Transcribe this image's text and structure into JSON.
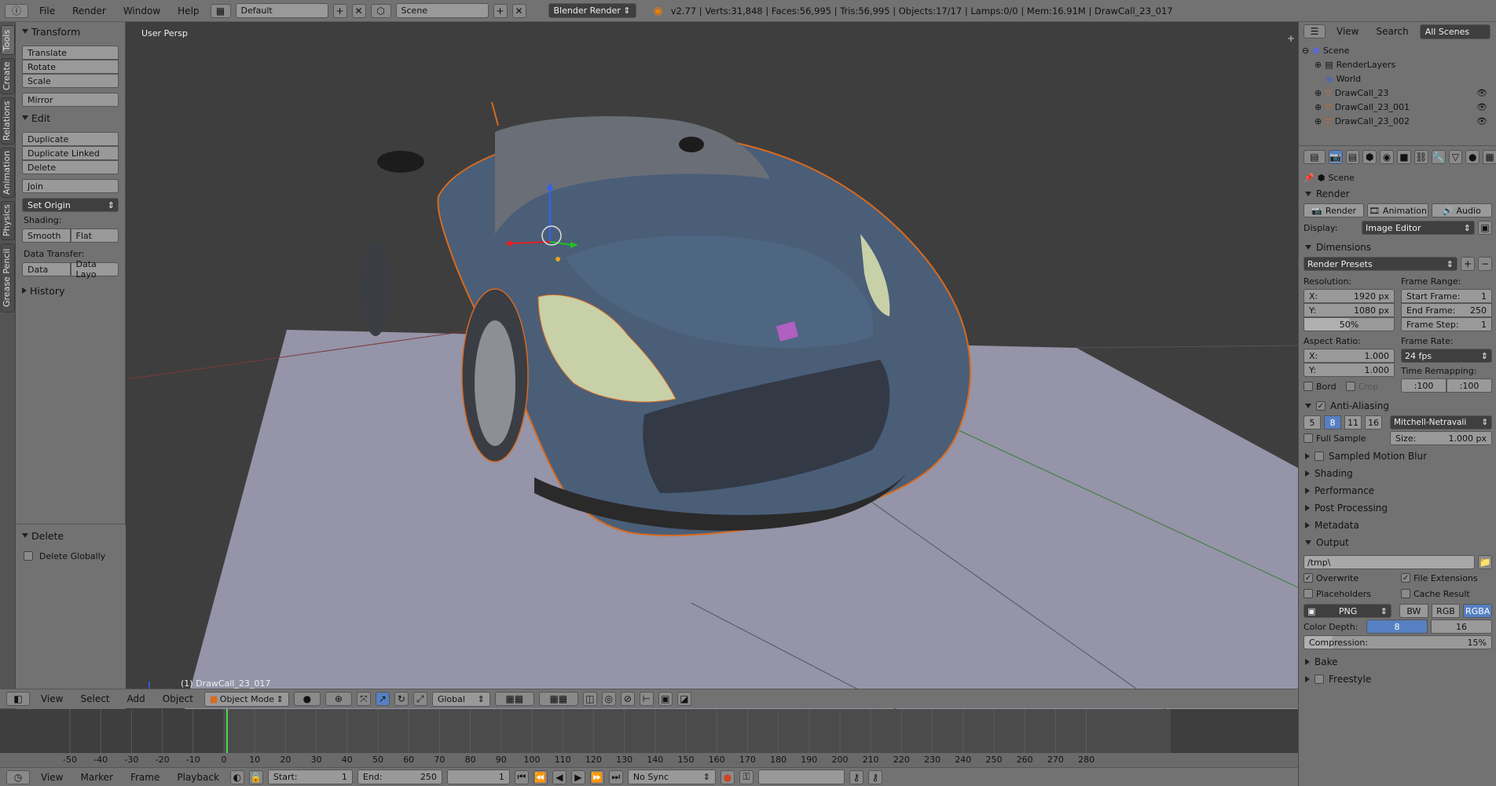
{
  "topbar": {
    "menus": [
      "File",
      "Render",
      "Window",
      "Help"
    ],
    "layout": "Default",
    "scene": "Scene",
    "engine": "Blender Render",
    "stats": "v2.77 | Verts:31,848 | Faces:56,995 | Tris:56,995 | Objects:17/17 | Lamps:0/0 | Mem:16.91M | DrawCall_23_017"
  },
  "lefttabs": [
    "Tools",
    "Create",
    "Relations",
    "Animation",
    "Physics",
    "Grease Pencil"
  ],
  "toolshelf": {
    "transform_title": "Transform",
    "translate": "Translate",
    "rotate": "Rotate",
    "scale": "Scale",
    "mirror": "Mirror",
    "edit_title": "Edit",
    "duplicate": "Duplicate",
    "duplicate_linked": "Duplicate Linked",
    "delete": "Delete",
    "join": "Join",
    "set_origin": "Set Origin",
    "shading_label": "Shading:",
    "smooth": "Smooth",
    "flat": "Flat",
    "data_transfer_label": "Data Transfer:",
    "data": "Data",
    "data_layout": "Data Layo",
    "history_title": "History",
    "op_title": "Delete",
    "delete_globally": "Delete Globally"
  },
  "viewport": {
    "label": "User Persp",
    "object_label": "(1) DrawCall_23_017"
  },
  "vp_header": {
    "menus": [
      "View",
      "Select",
      "Add",
      "Object"
    ],
    "mode": "Object Mode",
    "orientation": "Global"
  },
  "timeline": {
    "ticks": [
      "-50",
      "-40",
      "-30",
      "-20",
      "-10",
      "0",
      "10",
      "20",
      "30",
      "40",
      "50",
      "60",
      "70",
      "80",
      "90",
      "100",
      "110",
      "120",
      "130",
      "140",
      "150",
      "160",
      "170",
      "180",
      "190",
      "200",
      "210",
      "220",
      "230",
      "240",
      "250",
      "260",
      "270",
      "280"
    ],
    "current_frame_value": 1
  },
  "tl_header": {
    "menus": [
      "View",
      "Marker",
      "Frame",
      "Playback"
    ],
    "start_label": "Start:",
    "start_value": "1",
    "end_label": "End:",
    "end_value": "250",
    "current": "1",
    "sync": "No Sync"
  },
  "outliner": {
    "menus": [
      "View",
      "Search"
    ],
    "filter": "All Scenes",
    "rows": [
      "Scene",
      "RenderLayers",
      "World",
      "DrawCall_23",
      "DrawCall_23_001",
      "DrawCall_23_002"
    ]
  },
  "properties": {
    "context": "Scene",
    "render_section": "Render",
    "render_btn": "Render",
    "animation_btn": "Animation",
    "audio_btn": "Audio",
    "display_label": "Display:",
    "display_value": "Image Editor",
    "dimensions": "Dimensions",
    "render_presets": "Render Presets",
    "resolution_label": "Resolution:",
    "res_x": "X:",
    "res_x_val": "1920 px",
    "res_y": "Y:",
    "res_y_val": "1080 px",
    "res_pct": "50%",
    "frame_range_label": "Frame Range:",
    "start_frame": "Start Frame:",
    "start_frame_val": "1",
    "end_frame": "End Frame:",
    "end_frame_val": "250",
    "frame_step": "Frame Step:",
    "frame_step_val": "1",
    "aspect_label": "Aspect Ratio:",
    "asp_x": "X:",
    "asp_x_val": "1.000",
    "asp_y": "Y:",
    "asp_y_val": "1.000",
    "frame_rate_label": "Frame Rate:",
    "fps": "24 fps",
    "time_remap_label": "Time Remapping:",
    "remap_old": ":100",
    "remap_new": ":100",
    "bord": "Bord",
    "crop": "Crop",
    "aa_section": "Anti-Aliasing",
    "aa_samples": [
      "5",
      "8",
      "11",
      "16"
    ],
    "aa_filter": "Mitchell-Netravali",
    "full_sample": "Full Sample",
    "size_label": "Size:",
    "size_val": "1.000 px",
    "motion_blur": "Sampled Motion Blur",
    "shading": "Shading",
    "performance": "Performance",
    "post_processing": "Post Processing",
    "metadata": "Metadata",
    "output": "Output",
    "output_path": "/tmp\\",
    "overwrite": "Overwrite",
    "file_extensions": "File Extensions",
    "placeholders": "Placeholders",
    "cache_result": "Cache Result",
    "format": "PNG",
    "bw": "BW",
    "rgb": "RGB",
    "rgba": "RGBA",
    "color_depth_label": "Color Depth:",
    "depth_8": "8",
    "depth_16": "16",
    "compression_label": "Compression:",
    "compression_val": "15%",
    "bake": "Bake",
    "freestyle": "Freestyle"
  }
}
